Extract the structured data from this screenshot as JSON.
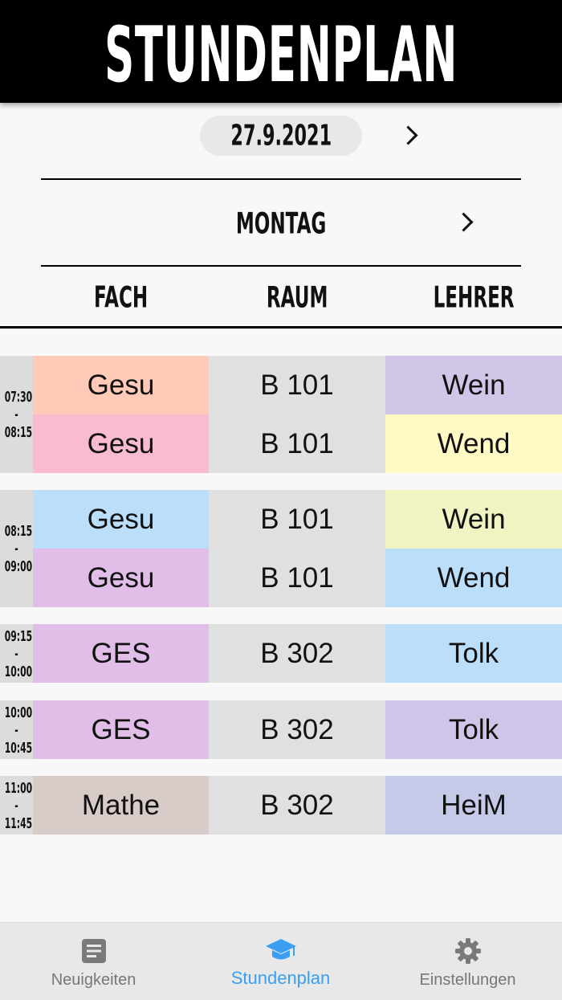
{
  "header": {
    "title": "STUNDENPLAN"
  },
  "date": {
    "value": "27.9.2021"
  },
  "day": {
    "label": "MONTAG"
  },
  "columns": {
    "subject": "FACH",
    "room": "RAUM",
    "teacher": "LEHRER"
  },
  "periods": [
    {
      "time_start": "07:30",
      "separator": "-",
      "time_end": "08:15",
      "rows": [
        {
          "subject": "Gesu",
          "room": "B 101",
          "teacher": "Wein",
          "subject_color": "#ffcbb8",
          "teacher_color": "#d2c6e8"
        },
        {
          "subject": "Gesu",
          "room": "B 101",
          "teacher": "Wend",
          "subject_color": "#f8bbd0",
          "teacher_color": "#fff9c4"
        }
      ]
    },
    {
      "time_start": "08:15",
      "separator": "-",
      "time_end": "09:00",
      "rows": [
        {
          "subject": "Gesu",
          "room": "B 101",
          "teacher": "Wein",
          "subject_color": "#bbdefb",
          "teacher_color": "#f0f4c3"
        },
        {
          "subject": "Gesu",
          "room": "B 101",
          "teacher": "Wend",
          "subject_color": "#e1bee7",
          "teacher_color": "#bbdefb"
        }
      ]
    },
    {
      "time_start": "09:15",
      "separator": "-",
      "time_end": "10:00",
      "rows": [
        {
          "subject": "GES",
          "room": "B 302",
          "teacher": "Tolk",
          "subject_color": "#e1bee7",
          "teacher_color": "#bbdefb"
        }
      ]
    },
    {
      "time_start": "10:00",
      "separator": "-",
      "time_end": "10:45",
      "rows": [
        {
          "subject": "GES",
          "room": "B 302",
          "teacher": "Tolk",
          "subject_color": "#e1bee7",
          "teacher_color": "#d1c4e9"
        }
      ]
    },
    {
      "time_start": "11:00",
      "separator": "-",
      "time_end": "11:45",
      "rows": [
        {
          "subject": "Mathe",
          "room": "B 302",
          "teacher": "HeiM",
          "subject_color": "#d7ccc8",
          "teacher_color": "#c5cae9"
        }
      ]
    }
  ],
  "tabs": [
    {
      "label": "Neuigkeiten",
      "icon": "news-icon",
      "active": false
    },
    {
      "label": "Stundenplan",
      "icon": "graduation-cap-icon",
      "active": true
    },
    {
      "label": "Einstellungen",
      "icon": "gear-icon",
      "active": false
    }
  ],
  "colors": {
    "room_cell": "#e0e0e0",
    "accent": "#3a9ff2",
    "header_bg": "#000000"
  }
}
